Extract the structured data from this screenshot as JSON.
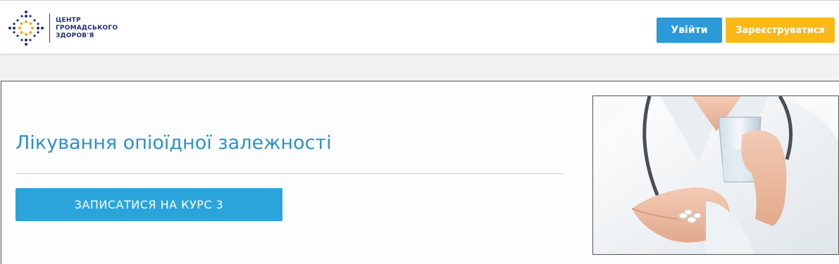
{
  "header": {
    "logo": {
      "lines": [
        "ЦЕНТР",
        "ГРОМАДСЬКОГО",
        "ЗДОРОВ'Я"
      ],
      "icon": "dotted-cross-logo-icon",
      "colors": {
        "navy": "#1f2f78",
        "orange": "#f5a623"
      }
    },
    "login_label": "Увійти",
    "register_label": "Зареєструватися"
  },
  "course": {
    "title": "Лікування опіоїдної залежності",
    "enroll_label": "ЗАПИСАТИСЯ НА КУРС 3",
    "image": "doctor-holding-pills-and-glass-image"
  },
  "colors": {
    "accent_blue": "#2a9ad9",
    "accent_yellow": "#fbb917",
    "title_blue": "#2d8fcf"
  }
}
